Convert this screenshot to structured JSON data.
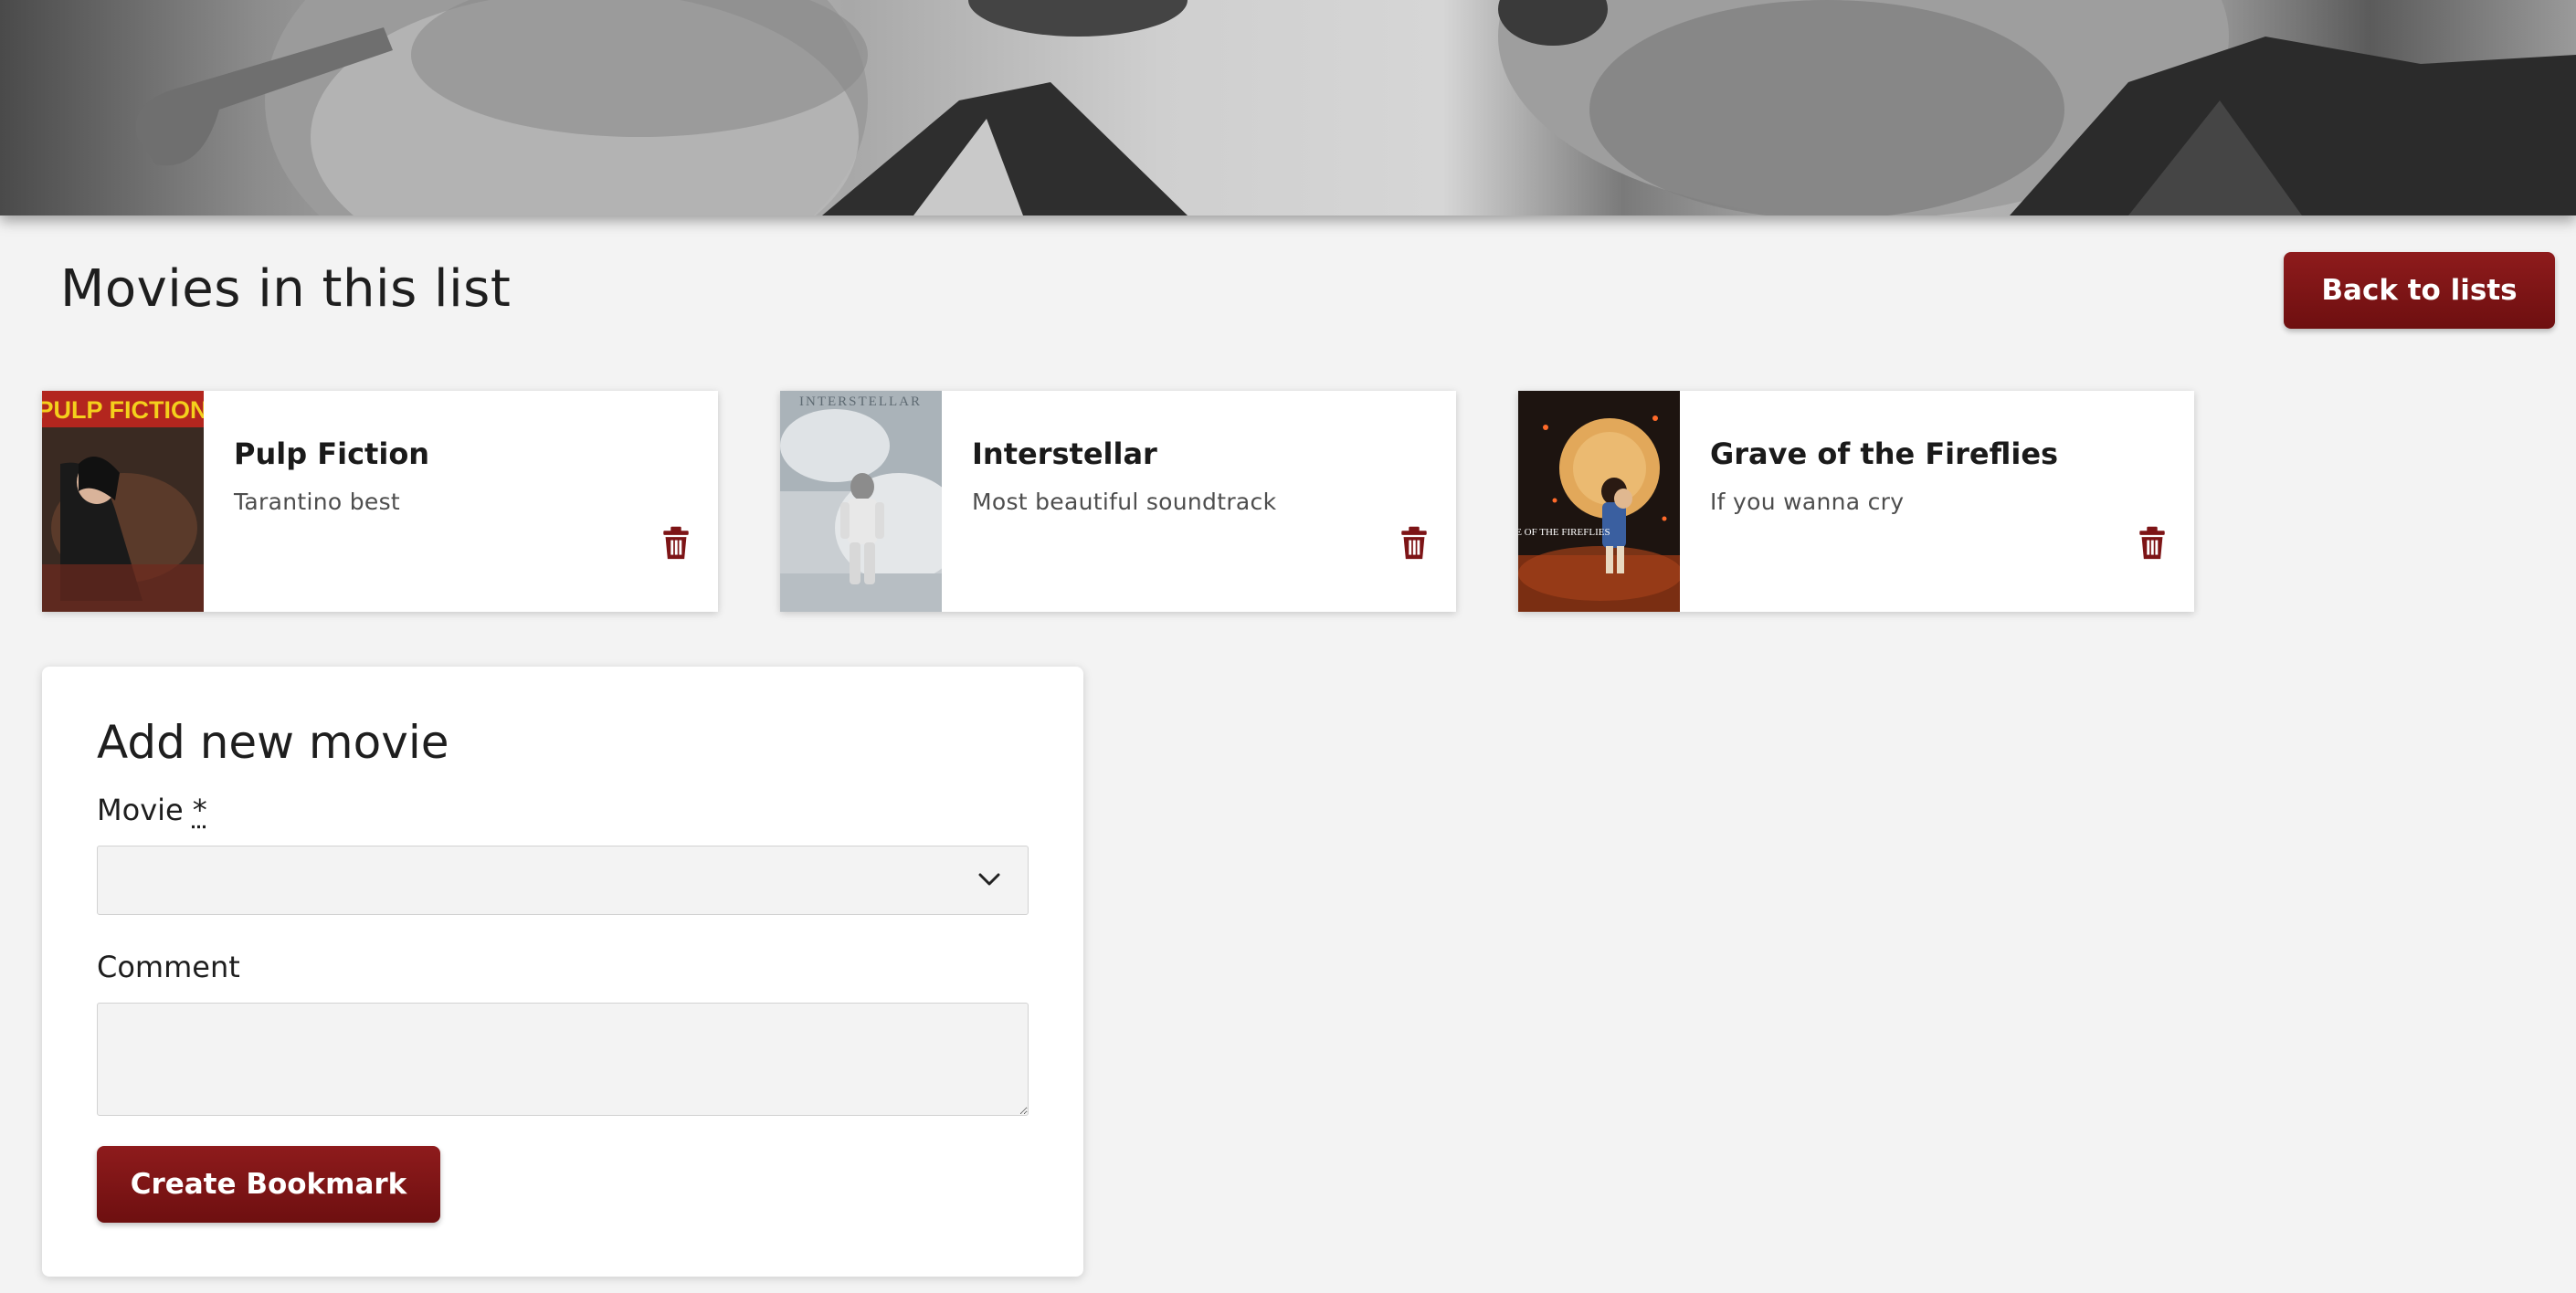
{
  "page": {
    "title": "Movies in this list",
    "back_button_label": "Back to lists"
  },
  "bookmarks": [
    {
      "title": "Pulp Fiction",
      "comment": "Tarantino best",
      "poster_text": "PULP FICTION"
    },
    {
      "title": "Interstellar",
      "comment": "Most beautiful soundtrack",
      "poster_text": "INTERSTELLAR"
    },
    {
      "title": "Grave of the Fireflies",
      "comment": "If you wanna cry",
      "poster_text": "GRAVE OF THE FIREFLIES"
    }
  ],
  "form": {
    "title": "Add new movie",
    "movie_label": "Movie",
    "required_marker": "*",
    "movie_value": "",
    "comment_label": "Comment",
    "comment_value": "",
    "submit_label": "Create Bookmark"
  },
  "icons": {
    "delete": "trash-icon",
    "dropdown": "chevron-down-icon"
  },
  "colors": {
    "accent": "#7d1416",
    "background": "#f3f3f3",
    "card": "#ffffff"
  }
}
